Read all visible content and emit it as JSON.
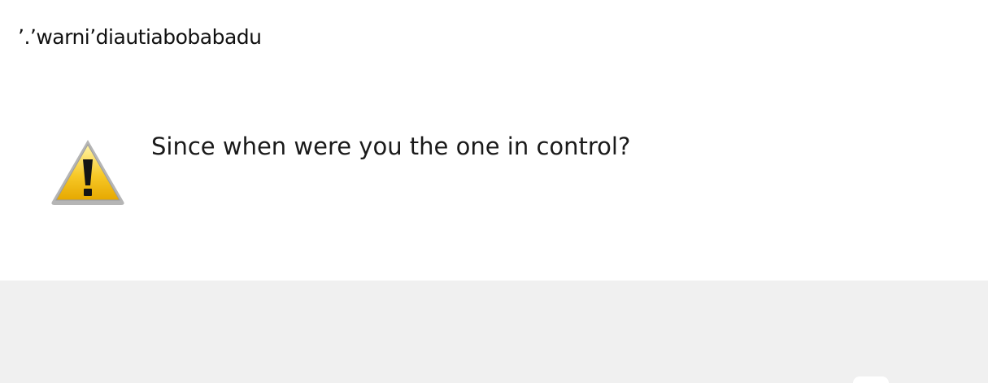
{
  "window": {
    "title": "ʼ.ʼwarniʼdiautiabobabadu"
  },
  "dialog": {
    "icon": "warning-icon",
    "message": "Since when were you the one in control?",
    "colors": {
      "icon_fill": "#f5c518",
      "icon_border": "#a8a8a8",
      "footer_bg": "#f0f0f0"
    }
  }
}
